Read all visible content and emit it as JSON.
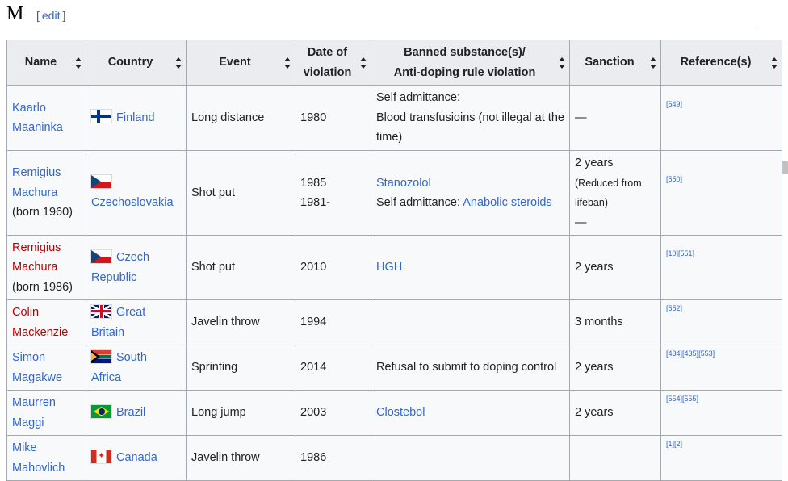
{
  "section": {
    "letter": "M",
    "edit_label": "edit",
    "bracket_open": "[",
    "bracket_close": "]"
  },
  "columns": [
    {
      "line1": "Name"
    },
    {
      "line1": "Country"
    },
    {
      "line1": "Event"
    },
    {
      "line1": "Date of",
      "line2": "violation"
    },
    {
      "line1": "Banned substance(s)/",
      "line2": "Anti-doping rule violation"
    },
    {
      "line1": "Sanction"
    },
    {
      "line1": "Reference(s)"
    }
  ],
  "rows": [
    {
      "name1": "Kaarlo",
      "name2": "Maaninka",
      "name3": "",
      "country1": "Finland",
      "country2": "",
      "flag": "finland-flag-icon",
      "event": "Long distance",
      "date1": "1980",
      "date2": "",
      "sub_prefix": "Self admittance:",
      "sub_text": "Blood transfusioins (not illegal at the time)",
      "sanction1": "—",
      "sanction_small": "",
      "sanction3": "",
      "refs": [
        "[549]"
      ]
    },
    {
      "name1": "Remigius",
      "name2": "Machura",
      "name3": "(born 1960)",
      "country1": "Czechoslovakia",
      "country2": "",
      "flag": "czechoslovakia-flag-icon",
      "event": "Shot put",
      "date1": "1985",
      "date2": "1981-",
      "sub_link1": "Stanozolol",
      "sub_prefix": "Self admittance:",
      "sub_link2": "Anabolic steroids",
      "sanction1": "2 years",
      "sanction_small": "(Reduced from lifeban)",
      "sanction3": "—",
      "refs": [
        "[550]"
      ]
    },
    {
      "name1": "Remigius",
      "name2": "Machura",
      "name3": "(born 1986)",
      "country1": "Czech",
      "country2": "Republic",
      "flag": "czech-republic-flag-icon",
      "event": "Shot put",
      "date1": "2010",
      "sub_link1": "HGH",
      "sanction1": "2 years",
      "refs": [
        "[10]",
        "[551]"
      ]
    },
    {
      "name1": "Colin",
      "name2": "Mackenzie",
      "country1": "Great",
      "country2": "Britain",
      "flag": "great-britain-flag-icon",
      "event": "Javelin throw",
      "date1": "1994",
      "sanction1": "3 months",
      "refs": [
        "[552]"
      ]
    },
    {
      "name1": "Simon",
      "name2": "Magakwe",
      "country1": "South",
      "country2": "Africa",
      "flag": "south-africa-flag-icon",
      "event": "Sprinting",
      "date1": "2014",
      "sub_text": "Refusal to submit to doping control",
      "sanction1": "2 years",
      "refs": [
        "[434]",
        "[435]",
        "[553]"
      ]
    },
    {
      "name1": "Maurren",
      "name2": "Maggi",
      "country1": "Brazil",
      "flag": "brazil-flag-icon",
      "event": "Long jump",
      "date1": "2003",
      "sub_link1": "Clostebol",
      "sanction1": "2 years",
      "refs": [
        "[554]",
        "[555]"
      ]
    },
    {
      "name1": "Mike",
      "name2": "Mahovlich",
      "country1": "Canada",
      "flag": "canada-flag-icon",
      "event": "Javelin throw",
      "date1": "1986",
      "refs": [
        "[1]",
        "[2]"
      ]
    }
  ]
}
